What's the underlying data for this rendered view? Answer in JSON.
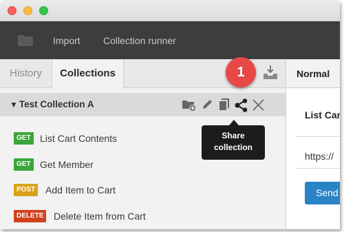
{
  "toolbar": {
    "import_label": "Import",
    "runner_label": "Collection runner"
  },
  "sidebar": {
    "tabs": [
      {
        "label": "History",
        "active": false
      },
      {
        "label": "Collections",
        "active": true
      }
    ],
    "collection": {
      "title": "Test Collection A",
      "expanded": true,
      "actions": [
        "add-folder-icon",
        "edit-icon",
        "duplicate-icon",
        "share-icon",
        "delete-icon"
      ]
    },
    "requests": [
      {
        "method": "GET",
        "name": "List Cart Contents",
        "color": "#3aa63a"
      },
      {
        "method": "GET",
        "name": "Get Member",
        "color": "#3aa63a"
      },
      {
        "method": "POST",
        "name": "Add Item to Cart",
        "color": "#d9a21a"
      },
      {
        "method": "DELETE",
        "name": "Delete Item from Cart",
        "color": "#d2401e"
      }
    ]
  },
  "annotation": {
    "badge": "1",
    "badge_color": "#e84848",
    "tooltip_line1": "Share",
    "tooltip_line2": "collection"
  },
  "request_pane": {
    "mode_tab": "Normal",
    "request_name": "List Car",
    "url": "https://",
    "send_label": "Send",
    "send_color": "#2a83c5"
  }
}
